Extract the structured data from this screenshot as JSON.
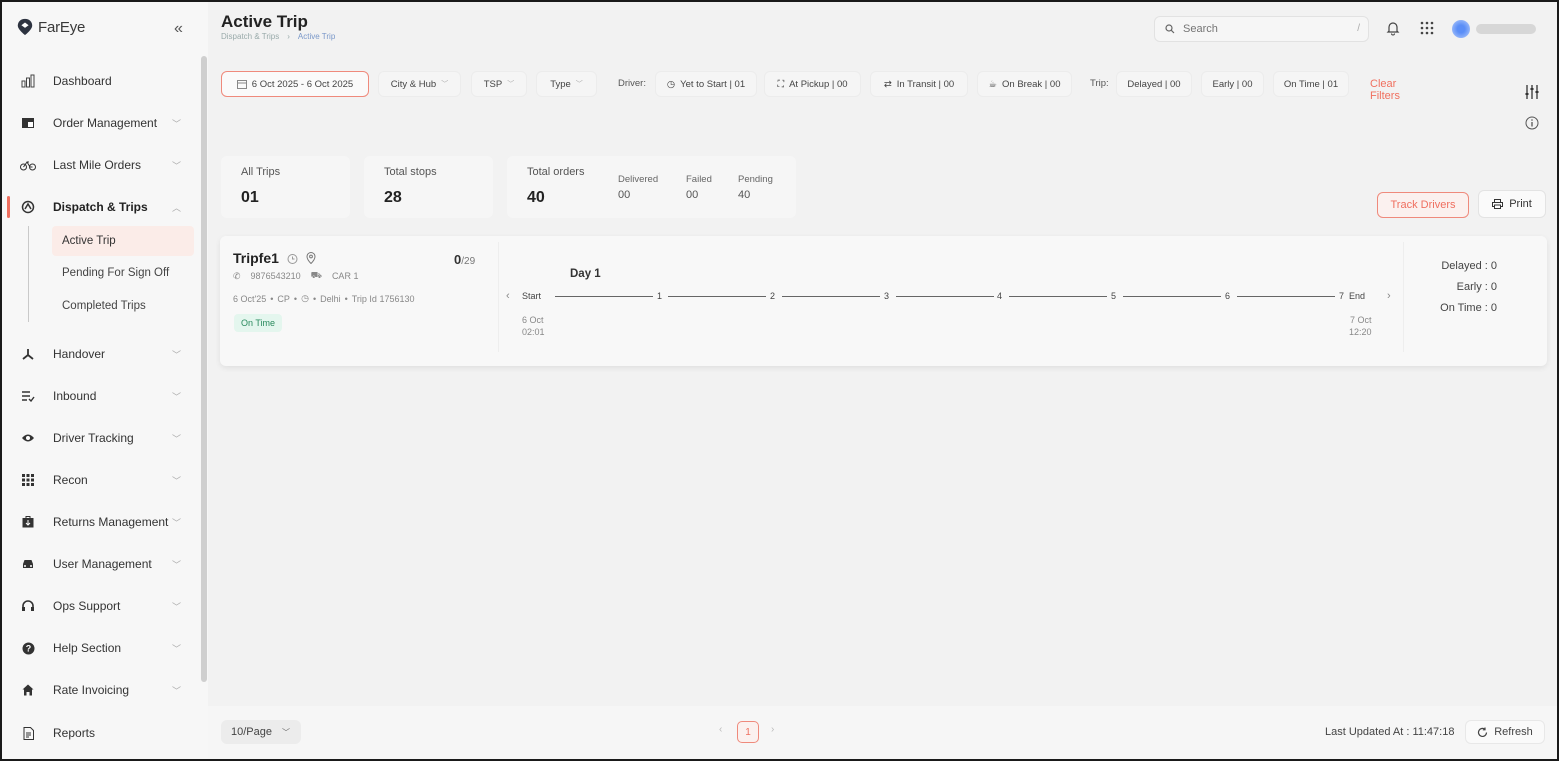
{
  "brand": {
    "name": "FarEye",
    "accent": "#ef6f5f"
  },
  "sidebar": {
    "items": [
      {
        "label": "Dashboard",
        "icon": "bar-chart-icon"
      },
      {
        "label": "Order Management",
        "icon": "window-icon"
      },
      {
        "label": "Last Mile Orders",
        "icon": "bicycle-icon"
      },
      {
        "label": "Dispatch & Trips",
        "icon": "route-icon"
      },
      {
        "label": "Handover",
        "icon": "handover-icon"
      },
      {
        "label": "Inbound",
        "icon": "list-check-icon"
      },
      {
        "label": "Driver Tracking",
        "icon": "eye-icon"
      },
      {
        "label": "Recon",
        "icon": "grid-icon"
      },
      {
        "label": "Returns Management",
        "icon": "box-icon"
      },
      {
        "label": "User Management",
        "icon": "car-icon"
      },
      {
        "label": "Ops Support",
        "icon": "headset-icon"
      },
      {
        "label": "Help Section",
        "icon": "help-icon"
      },
      {
        "label": "Rate Invoicing",
        "icon": "home-icon"
      },
      {
        "label": "Reports",
        "icon": "document-icon"
      }
    ],
    "sub_items": [
      {
        "label": "Active Trip"
      },
      {
        "label": "Pending For Sign Off"
      },
      {
        "label": "Completed Trips"
      }
    ]
  },
  "header": {
    "title": "Active Trip",
    "breadcrumb": [
      "Dispatch & Trips",
      "Active Trip"
    ],
    "search_placeholder": "Search",
    "search_shortcut": "/"
  },
  "filters": {
    "date": "6 Oct 2025 - 6 Oct 2025",
    "city_hub": "City & Hub",
    "tsp": "TSP",
    "type": "Type",
    "driver_label": "Driver:",
    "yet_to_start": "Yet to Start | 01",
    "at_pickup": "At Pickup | 00",
    "in_transit": "In Transit | 00",
    "on_break": "On Break | 00",
    "trip_label": "Trip:",
    "delayed": "Delayed | 00",
    "early": "Early | 00",
    "on_time": "On Time | 01",
    "clear": "Clear Filters"
  },
  "stats": {
    "all_trips": {
      "label": "All Trips",
      "value": "01"
    },
    "total_stops": {
      "label": "Total stops",
      "value": "28"
    },
    "total_orders": {
      "label": "Total orders",
      "value": "40"
    },
    "delivered": {
      "label": "Delivered",
      "value": "00"
    },
    "failed": {
      "label": "Failed",
      "value": "00"
    },
    "pending": {
      "label": "Pending",
      "value": "40"
    }
  },
  "actions": {
    "track_drivers": "Track Drivers",
    "print": "Print"
  },
  "trip": {
    "name": "Tripfe1",
    "completed": "0",
    "total": "/29",
    "phone": "9876543210",
    "vehicle": "CAR 1",
    "date": "6 Oct'25",
    "hub": "CP",
    "city": "Delhi",
    "trip_id": "Trip Id 1756130",
    "status": "On Time",
    "day": "Day 1",
    "stops": [
      "Start",
      "1",
      "2",
      "3",
      "4",
      "5",
      "6",
      "7",
      "End"
    ],
    "start_date": "6 Oct",
    "start_time": "02:01",
    "end_date": "7 Oct",
    "end_time": "12:20",
    "delayed": "Delayed : 0",
    "early": "Early : 0",
    "on_time": "On Time : 0"
  },
  "footer": {
    "per_page": "10/Page",
    "current_page": "1",
    "last_updated": "Last Updated At : 11:47:18",
    "refresh": "Refresh"
  }
}
